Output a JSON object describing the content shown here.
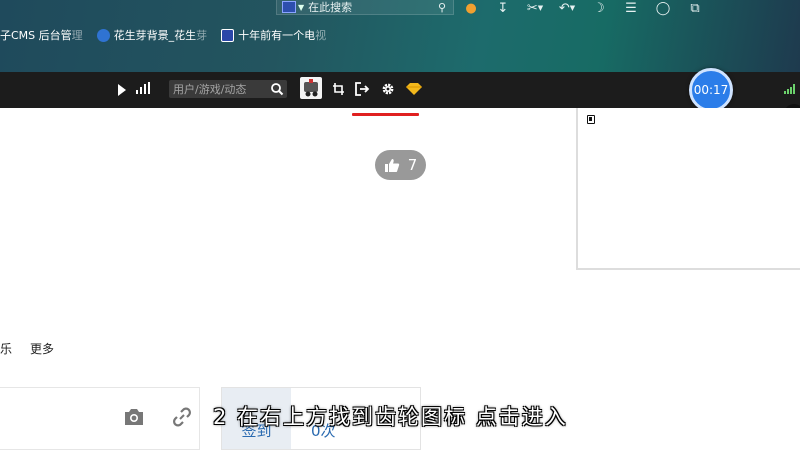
{
  "browser": {
    "search": {
      "value": "在此搜索"
    },
    "toolbar_icons": [
      "game-icon",
      "download-icon",
      "scissors-icon",
      "undo-icon",
      "moon-icon",
      "menu-icon",
      "shirt-icon",
      "restore-window-icon"
    ],
    "bookmarks": [
      {
        "label": "子CMS 后台管",
        "fade": "理",
        "icon": "edge-icon",
        "color": "#0aa7d8"
      },
      {
        "label": "花生芽背景_花生",
        "fade": "芽",
        "icon": "peanut-icon",
        "color": "#2f73d2"
      },
      {
        "label": "十年前有一个电",
        "fade": "视",
        "icon": "pixel-icon",
        "color": "#2b47a8"
      }
    ]
  },
  "sitebar": {
    "search_placeholder": "用户/游戏/动态",
    "timer": "00:17"
  },
  "content": {
    "like_count": "7",
    "tabs": [
      "乐",
      "更多"
    ],
    "signin": {
      "label": "签到",
      "count": "0次"
    },
    "subtitle": "2  在右上方找到齿轮图标  点击进入"
  },
  "colors": {
    "accent_red": "#e02020",
    "timer_blue": "#2b7de9"
  }
}
